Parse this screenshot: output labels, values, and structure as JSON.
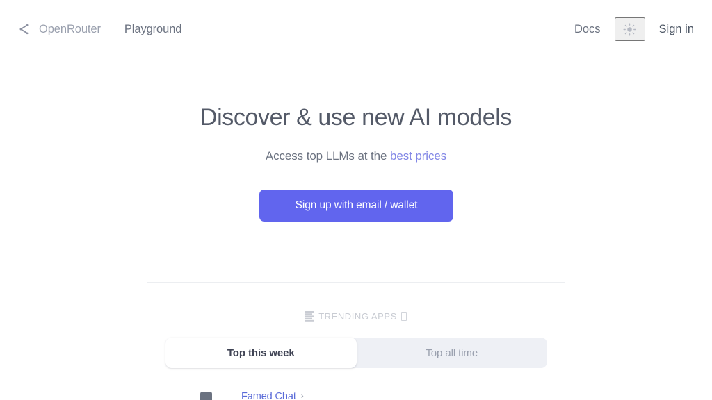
{
  "header": {
    "brand_icon": "share-network-icon",
    "brand_name": "OpenRouter",
    "nav_playground": "Playground",
    "docs": "Docs",
    "theme_icon": "sun-icon",
    "sign_in": "Sign in"
  },
  "hero": {
    "title": "Discover & use new AI models",
    "subtitle_prefix": "Access top LLMs at the ",
    "subtitle_link": "best prices",
    "cta_label": "Sign up with email / wallet",
    "cta_color": "#6165ee",
    "link_color": "#8287e6"
  },
  "trending": {
    "leading_icon": "bar-chart-icon",
    "label": "TRENDING APPS",
    "trailing_icon": "missing-glyph-box",
    "trailing_glyph": "□"
  },
  "tabs": [
    {
      "label": "Top this week",
      "active": true
    },
    {
      "label": "Top all time",
      "active": false
    }
  ],
  "apps": [
    {
      "name": "Famed Chat",
      "chevron": "›",
      "icon": "app-favicon"
    }
  ]
}
